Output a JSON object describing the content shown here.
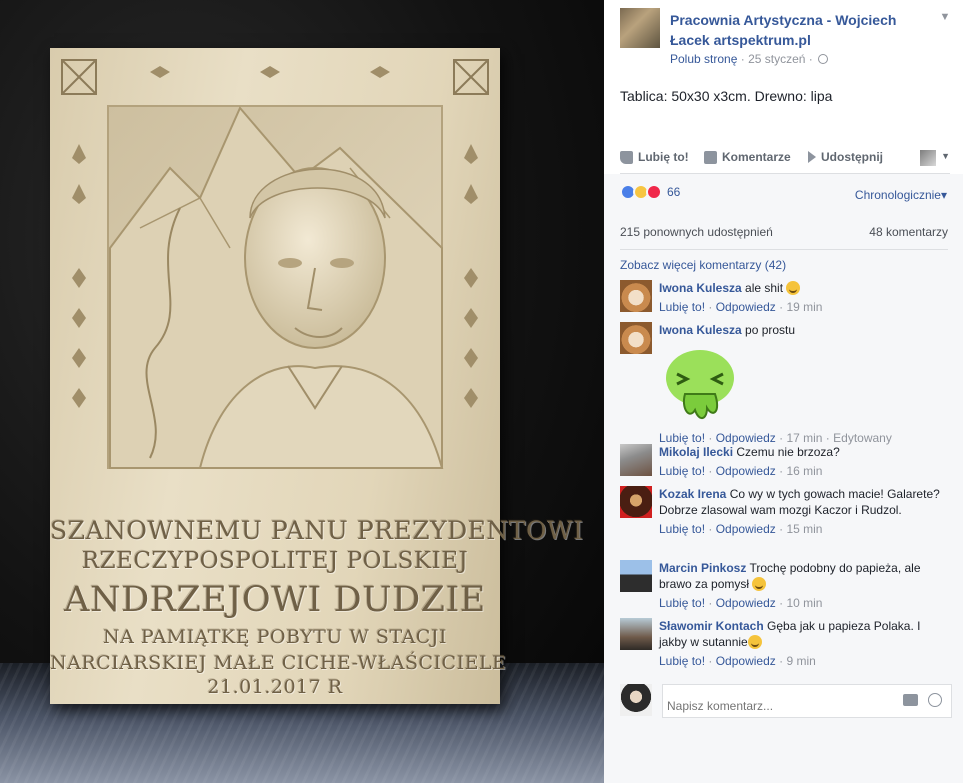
{
  "plaque": {
    "line1": "SZANOWNEMU PANU PREZYDENTOWI",
    "line2": "RZECZYPOSPOLITEJ POLSKIEJ",
    "line3": "ANDRZEJOWI DUDZIE",
    "line4": "NA PAMIĄTKĘ POBYTU W STACJI",
    "line5": "NARCIARSKIEJ MAŁE CICHE-WŁAŚCICIELE",
    "line6": "21.01.2017 R"
  },
  "post": {
    "page_name": "Pracownia Artystyczna - Wojciech Łacek artspektrum.pl",
    "like_page": "Polub stronę",
    "date": "25 styczeń",
    "text": "Tablica: 50x30 x3cm. Drewno: lipa"
  },
  "actions": {
    "like": "Lubię to!",
    "comment": "Komentarze",
    "share": "Udostępnij"
  },
  "reactions": {
    "count": "66",
    "sort": "Chronologicznie"
  },
  "stats": {
    "shares": "215 ponownych udostępnień",
    "comments": "48 komentarzy",
    "more_comments": "Zobacz więcej komentarzy (42)"
  },
  "labels": {
    "like": "Lubię to!",
    "reply": "Odpowiedz",
    "sep": " · ",
    "edited": "Edytowany"
  },
  "comments": [
    {
      "author": "Iwona Kulesza",
      "text": "ale shit",
      "time": "19 min"
    },
    {
      "author": "Iwona Kulesza",
      "text": "po prostu",
      "time": "17 min"
    },
    {
      "author": "Mikolaj Ilecki",
      "text": "Czemu nie brzoza?",
      "time": "16 min"
    },
    {
      "author": "Kozak Irena",
      "text": "Co wy w tych gowach macie! Galarete? Dobrze zlasowal wam mozgi Kaczor i Rudzol.",
      "time": "15 min"
    },
    {
      "author": "Marcin Pinkosz",
      "text": "Trochę podobny do papieża, ale brawo za pomysł",
      "time": "10 min"
    },
    {
      "author": "Sławomir Kontach",
      "text": "Gęba jak u papieza Polaka. I jakby w sutannie",
      "time": "9 min"
    }
  ],
  "compose": {
    "placeholder": "Napisz komentarz..."
  }
}
